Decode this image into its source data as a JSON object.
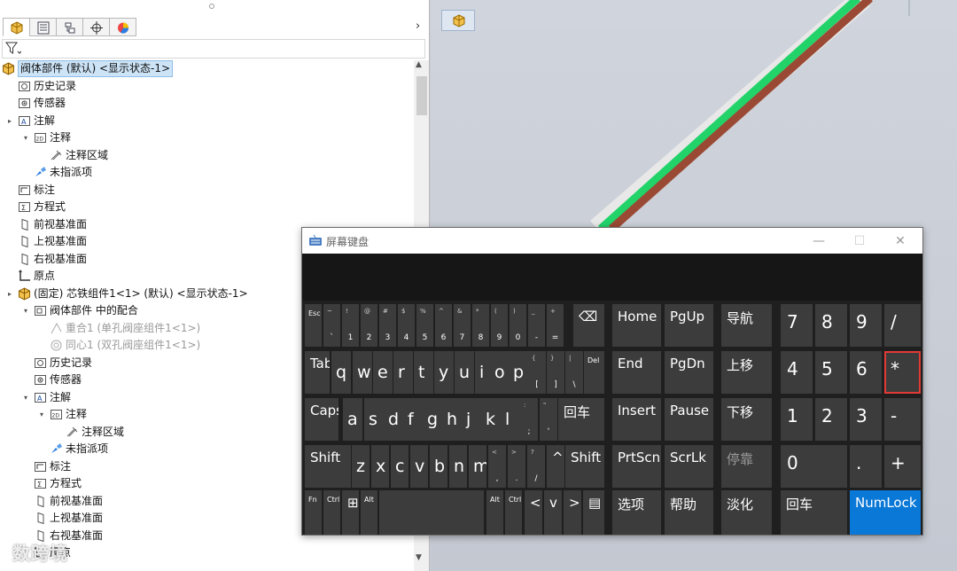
{
  "tree_panel": {
    "tabs": [
      "featuremanager-icon",
      "propertymanager-icon",
      "configurationmanager-icon",
      "dimxpert-icon",
      "display-manager-icon"
    ],
    "filter_icon": "filter-icon",
    "rows": [
      {
        "label": "阀体部件 (默认) <显示状态-1>",
        "level": 0,
        "toggle": "",
        "icon": "assembly-icon",
        "selected": true
      },
      {
        "label": "历史记录",
        "level": 1,
        "toggle": "",
        "icon": "history-icon"
      },
      {
        "label": "传感器",
        "level": 1,
        "toggle": "",
        "icon": "sensor-icon"
      },
      {
        "label": "注解",
        "level": 1,
        "toggle": "▸",
        "icon": "annotation-icon"
      },
      {
        "label": "注释",
        "level": 2,
        "toggle": "▾",
        "icon": "note-2d-icon"
      },
      {
        "label": "注释区域",
        "level": 3,
        "toggle": "",
        "icon": "note-area-icon"
      },
      {
        "label": "未指派项",
        "level": 2,
        "toggle": "",
        "icon": "unassigned-icon"
      },
      {
        "label": "标注",
        "level": 1,
        "toggle": "",
        "icon": "dimension-icon"
      },
      {
        "label": "方程式",
        "level": 1,
        "toggle": "",
        "icon": "equation-icon"
      },
      {
        "label": "前视基准面",
        "level": 1,
        "toggle": "",
        "icon": "plane-icon"
      },
      {
        "label": "上视基准面",
        "level": 1,
        "toggle": "",
        "icon": "plane-icon"
      },
      {
        "label": "右视基准面",
        "level": 1,
        "toggle": "",
        "icon": "plane-icon"
      },
      {
        "label": "原点",
        "level": 1,
        "toggle": "",
        "icon": "origin-icon"
      },
      {
        "label": "(固定) 芯铁组件1<1> (默认) <显示状态-1>",
        "level": 1,
        "toggle": "▸",
        "icon": "assembly-icon"
      },
      {
        "label": "阀体部件 中的配合",
        "level": 2,
        "toggle": "▾",
        "icon": "mates-icon"
      },
      {
        "label": "重合1 (单孔阀座组件1<1>)",
        "level": 3,
        "toggle": "",
        "icon": "coincident-icon",
        "gray": true
      },
      {
        "label": "同心1 (双孔阀座组件1<1>)",
        "level": 3,
        "toggle": "",
        "icon": "concentric-icon",
        "gray": true
      },
      {
        "label": "历史记录",
        "level": 2,
        "toggle": "",
        "icon": "history-icon"
      },
      {
        "label": "传感器",
        "level": 2,
        "toggle": "",
        "icon": "sensor-icon"
      },
      {
        "label": "注解",
        "level": 2,
        "toggle": "▾",
        "icon": "annotation-icon"
      },
      {
        "label": "注释",
        "level": 3,
        "toggle": "▾",
        "icon": "note-2d-icon"
      },
      {
        "label": "注释区域",
        "level": 4,
        "toggle": "",
        "icon": "note-area-icon"
      },
      {
        "label": "未指派项",
        "level": 3,
        "toggle": "",
        "icon": "unassigned-icon"
      },
      {
        "label": "标注",
        "level": 2,
        "toggle": "",
        "icon": "dimension-icon"
      },
      {
        "label": "方程式",
        "level": 2,
        "toggle": "",
        "icon": "equation-icon"
      },
      {
        "label": "前视基准面",
        "level": 2,
        "toggle": "",
        "icon": "plane-icon"
      },
      {
        "label": "上视基准面",
        "level": 2,
        "toggle": "",
        "icon": "plane-icon"
      },
      {
        "label": "右视基准面",
        "level": 2,
        "toggle": "",
        "icon": "plane-icon"
      },
      {
        "label": "原点",
        "level": 2,
        "toggle": "",
        "icon": "origin-icon"
      }
    ],
    "watermark": "数跨境"
  },
  "viewport": {
    "toolbar_icon": "assembly-view-icon",
    "pipe_colors": {
      "green": "#22d36a",
      "brown": "#9a4a34",
      "outline": "#e8e8e8"
    }
  },
  "osk": {
    "title": "屏幕键盘",
    "window_buttons": {
      "minimize": "—",
      "maximize": "☐",
      "close": "✕"
    },
    "colors": {
      "key": "#3c3c3c",
      "background": "#1f1f1f",
      "numlock": "#0a78d7",
      "highlight": "#e23a36"
    },
    "keys": [
      {
        "id": "esc",
        "main": "Esc",
        "cls": "tiny"
      },
      {
        "id": "k1",
        "top": "~",
        "bot": "`",
        "cls": "sm"
      },
      {
        "id": "k2",
        "top": "!",
        "bot": "1",
        "cls": "sm"
      },
      {
        "id": "k3",
        "top": "@",
        "bot": "2",
        "cls": "sm"
      },
      {
        "id": "k4",
        "top": "#",
        "bot": "3",
        "cls": "sm"
      },
      {
        "id": "k5",
        "top": "$",
        "bot": "4",
        "cls": "sm"
      },
      {
        "id": "k6",
        "top": "%",
        "bot": "5",
        "cls": "sm"
      },
      {
        "id": "k7",
        "top": "^",
        "bot": "6",
        "cls": "sm"
      },
      {
        "id": "k8",
        "top": "&",
        "bot": "7",
        "cls": "sm"
      },
      {
        "id": "k9",
        "top": "*",
        "bot": "8",
        "cls": "sm"
      },
      {
        "id": "k10",
        "top": "(",
        "bot": "9",
        "cls": "sm"
      },
      {
        "id": "k11",
        "top": ")",
        "bot": "0",
        "cls": "sm"
      },
      {
        "id": "k12",
        "top": "_",
        "bot": "-",
        "cls": "sm"
      },
      {
        "id": "k13",
        "top": "+",
        "bot": "=",
        "cls": "sm"
      },
      {
        "id": "bksp",
        "main": "⌫",
        "cls": ""
      },
      {
        "id": "tab",
        "main": "Tab",
        "cls": ""
      },
      {
        "id": "q",
        "main": "q",
        "cls": "alpha"
      },
      {
        "id": "w",
        "main": "w",
        "cls": "alpha"
      },
      {
        "id": "e",
        "main": "e",
        "cls": "alpha"
      },
      {
        "id": "r",
        "main": "r",
        "cls": "alpha"
      },
      {
        "id": "t",
        "main": "t",
        "cls": "alpha"
      },
      {
        "id": "y",
        "main": "y",
        "cls": "alpha"
      },
      {
        "id": "u",
        "main": "u",
        "cls": "alpha"
      },
      {
        "id": "i",
        "main": "i",
        "cls": "alpha"
      },
      {
        "id": "o",
        "main": "o",
        "cls": "alpha"
      },
      {
        "id": "p",
        "main": "p",
        "cls": "alpha"
      },
      {
        "id": "lbr",
        "top": "{",
        "bot": "[",
        "cls": "sm"
      },
      {
        "id": "rbr",
        "top": "}",
        "bot": "]",
        "cls": "sm"
      },
      {
        "id": "bsl",
        "top": "|",
        "bot": "\\",
        "cls": "sm"
      },
      {
        "id": "del",
        "main": "Del",
        "cls": "tiny"
      },
      {
        "id": "caps",
        "main": "Caps",
        "cls": ""
      },
      {
        "id": "a",
        "main": "a",
        "cls": "alpha"
      },
      {
        "id": "s",
        "main": "s",
        "cls": "alpha"
      },
      {
        "id": "d",
        "main": "d",
        "cls": "alpha"
      },
      {
        "id": "f",
        "main": "f",
        "cls": "alpha"
      },
      {
        "id": "g",
        "main": "g",
        "cls": "alpha"
      },
      {
        "id": "h",
        "main": "h",
        "cls": "alpha"
      },
      {
        "id": "j",
        "main": "j",
        "cls": "alpha"
      },
      {
        "id": "k",
        "main": "k",
        "cls": "alpha"
      },
      {
        "id": "l",
        "main": "l",
        "cls": "alpha"
      },
      {
        "id": "semi",
        "top": ":",
        "bot": ";",
        "cls": "sm"
      },
      {
        "id": "quote",
        "top": "\"",
        "bot": "'",
        "cls": "sm"
      },
      {
        "id": "enter",
        "main": "回车",
        "cls": "cn"
      },
      {
        "id": "lshift",
        "main": "Shift",
        "cls": ""
      },
      {
        "id": "z",
        "main": "z",
        "cls": "alpha"
      },
      {
        "id": "x",
        "main": "x",
        "cls": "alpha"
      },
      {
        "id": "c",
        "main": "c",
        "cls": "alpha"
      },
      {
        "id": "v",
        "main": "v",
        "cls": "alpha"
      },
      {
        "id": "b",
        "main": "b",
        "cls": "alpha"
      },
      {
        "id": "n",
        "main": "n",
        "cls": "alpha"
      },
      {
        "id": "m",
        "main": "m",
        "cls": "alpha"
      },
      {
        "id": "comma",
        "top": "<",
        "bot": ",",
        "cls": "sm"
      },
      {
        "id": "period",
        "top": ">",
        "bot": ".",
        "cls": "sm"
      },
      {
        "id": "slash",
        "top": "?",
        "bot": "/",
        "cls": "sm"
      },
      {
        "id": "up",
        "main": "^",
        "cls": ""
      },
      {
        "id": "rshift",
        "main": "Shift",
        "cls": ""
      },
      {
        "id": "fn",
        "main": "Fn",
        "cls": "tiny"
      },
      {
        "id": "lctrl",
        "main": "Ctrl",
        "cls": "tiny"
      },
      {
        "id": "win",
        "main": "⊞",
        "cls": ""
      },
      {
        "id": "lalt",
        "main": "Alt",
        "cls": "tiny"
      },
      {
        "id": "space",
        "main": "",
        "cls": ""
      },
      {
        "id": "ralt",
        "main": "Alt",
        "cls": "tiny"
      },
      {
        "id": "rctrl",
        "main": "Ctrl",
        "cls": "tiny"
      },
      {
        "id": "left",
        "main": "<",
        "cls": ""
      },
      {
        "id": "down",
        "main": "v",
        "cls": ""
      },
      {
        "id": "right",
        "main": ">",
        "cls": ""
      },
      {
        "id": "menu",
        "main": "▤",
        "cls": ""
      },
      {
        "id": "home",
        "main": "Home",
        "cls": ""
      },
      {
        "id": "pgup",
        "main": "PgUp",
        "cls": ""
      },
      {
        "id": "nav",
        "main": "导航",
        "cls": "cn"
      },
      {
        "id": "end",
        "main": "End",
        "cls": ""
      },
      {
        "id": "pgdn",
        "main": "PgDn",
        "cls": ""
      },
      {
        "id": "mvup",
        "main": "上移",
        "cls": "cn"
      },
      {
        "id": "insert",
        "main": "Insert",
        "cls": ""
      },
      {
        "id": "pause",
        "main": "Pause",
        "cls": ""
      },
      {
        "id": "mvdn",
        "main": "下移",
        "cls": "cn"
      },
      {
        "id": "prtscn",
        "main": "PrtScn",
        "cls": ""
      },
      {
        "id": "scrlk",
        "main": "ScrLk",
        "cls": ""
      },
      {
        "id": "dock",
        "main": "停靠",
        "cls": "cn dim"
      },
      {
        "id": "options",
        "main": "选项",
        "cls": "cn"
      },
      {
        "id": "help",
        "main": "帮助",
        "cls": "cn"
      },
      {
        "id": "fade",
        "main": "淡化",
        "cls": "cn"
      },
      {
        "id": "n7",
        "main": "7",
        "cls": "num"
      },
      {
        "id": "n8",
        "main": "8",
        "cls": "num"
      },
      {
        "id": "n9",
        "main": "9",
        "cls": "num"
      },
      {
        "id": "ndiv",
        "main": "/",
        "cls": "num"
      },
      {
        "id": "n4",
        "main": "4",
        "cls": "num"
      },
      {
        "id": "n5",
        "main": "5",
        "cls": "num"
      },
      {
        "id": "n6",
        "main": "6",
        "cls": "num"
      },
      {
        "id": "nmul",
        "main": "*",
        "cls": "num hl"
      },
      {
        "id": "n1",
        "main": "1",
        "cls": "num"
      },
      {
        "id": "n2",
        "main": "2",
        "cls": "num"
      },
      {
        "id": "n3",
        "main": "3",
        "cls": "num"
      },
      {
        "id": "nsub",
        "main": "-",
        "cls": "num"
      },
      {
        "id": "n0",
        "main": "0",
        "cls": "num"
      },
      {
        "id": "ndot",
        "main": ".",
        "cls": "num"
      },
      {
        "id": "nadd",
        "main": "+",
        "cls": "num"
      },
      {
        "id": "nenter",
        "main": "回车",
        "cls": "cn"
      },
      {
        "id": "numlock",
        "main": "NumLock",
        "cls": "numlock"
      }
    ]
  }
}
